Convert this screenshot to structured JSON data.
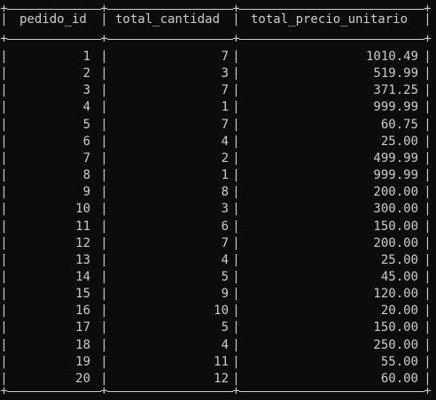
{
  "table": {
    "columns": [
      "pedido_id",
      "total_cantidad",
      "total_precio_unitario"
    ],
    "rows": [
      [
        "1",
        "7",
        "1010.49"
      ],
      [
        "2",
        "3",
        "519.99"
      ],
      [
        "3",
        "7",
        "371.25"
      ],
      [
        "4",
        "1",
        "999.99"
      ],
      [
        "5",
        "7",
        "60.75"
      ],
      [
        "6",
        "4",
        "25.00"
      ],
      [
        "7",
        "2",
        "499.99"
      ],
      [
        "8",
        "1",
        "999.99"
      ],
      [
        "9",
        "8",
        "200.00"
      ],
      [
        "10",
        "3",
        "300.00"
      ],
      [
        "11",
        "6",
        "150.00"
      ],
      [
        "12",
        "7",
        "200.00"
      ],
      [
        "13",
        "4",
        "25.00"
      ],
      [
        "14",
        "5",
        "45.00"
      ],
      [
        "15",
        "9",
        "120.00"
      ],
      [
        "16",
        "10",
        "20.00"
      ],
      [
        "17",
        "5",
        "150.00"
      ],
      [
        "18",
        "4",
        "250.00"
      ],
      [
        "19",
        "11",
        "55.00"
      ],
      [
        "20",
        "12",
        "60.00"
      ]
    ]
  },
  "theme": {
    "background": "#0c0c0c",
    "foreground": "#cccccc"
  }
}
